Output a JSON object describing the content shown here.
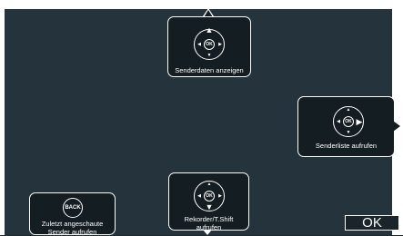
{
  "panels": {
    "top": {
      "label": "Senderdaten anzeigen",
      "ok": "OK"
    },
    "right": {
      "label": "Senderliste aufrufen",
      "ok": "OK"
    },
    "bottom": {
      "label": "Rekorder/T.Shift aufrufen",
      "ok": "OK"
    },
    "bottom_left": {
      "label": "Zuletzt angeschaute Sender aufrufen",
      "button": "BACK"
    }
  },
  "ok_button": {
    "label": "OK"
  },
  "icons": [
    "up-arrow-icon",
    "down-arrow-icon",
    "left-arrow-icon",
    "right-arrow-icon",
    "ok-circle-icon",
    "back-circle-icon"
  ]
}
